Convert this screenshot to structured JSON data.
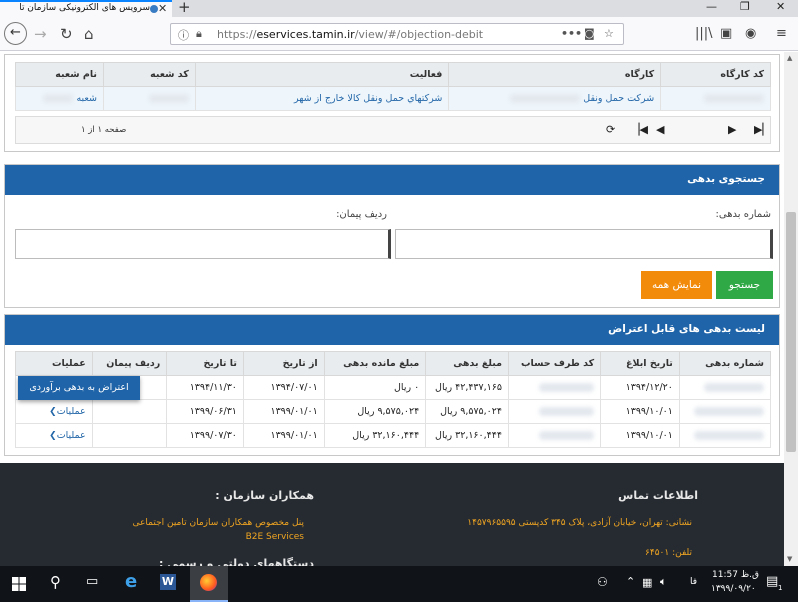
{
  "browser": {
    "tab_title": "سرویس های الکترونیکی سازمان تا",
    "url_prefix": "https://",
    "url_host": "eservices.tamin.ir",
    "url_path": "/view/#/objection-debit"
  },
  "workshop_table": {
    "headers": [
      "کد کارگاه",
      "کارگاه",
      "فعالیت",
      "کد شعبه",
      "نام شعبه"
    ],
    "row": {
      "company": "شرکت حمل ونقل",
      "activity": "شرکتهاي حمل ونقل کالا خارج از شهر",
      "branch_prefix": "شعبه"
    },
    "pager_text": "صفحه ۱ از ۱"
  },
  "search_panel": {
    "title": "جستجوی بدهی",
    "debt_number_label": "شماره بدهی:",
    "contract_row_label": "ردیف پیمان:",
    "search_button": "جستجو",
    "show_all_button": "نمایش همه"
  },
  "debt_list": {
    "title": "لیست بدهی های قابل اعتراض",
    "headers": [
      "شماره بدهی",
      "تاریخ ابلاغ",
      "کد طرف حساب",
      "مبلغ بدهی",
      "مبلغ مانده بدهی",
      "از تاریخ",
      "تا تاریخ",
      "ردیف پیمان",
      "عملیات"
    ],
    "rows": [
      {
        "notify_date": "۱۳۹۴/۱۲/۲۰",
        "amount": "۴۲,۴۳۷,۱۶۵ ریال",
        "remaining": "۰ ریال",
        "from": "۱۳۹۴/۰۷/۰۱",
        "to": "۱۳۹۴/۱۱/۳۰",
        "action": ""
      },
      {
        "notify_date": "۱۳۹۹/۱۰/۰۱",
        "amount": "۹,۵۷۵,۰۲۴ ریال",
        "remaining": "۹,۵۷۵,۰۲۴ ریال",
        "from": "۱۳۹۹/۰۱/۰۱",
        "to": "۱۳۹۹/۰۶/۳۱",
        "action": "عملیات"
      },
      {
        "notify_date": "۱۳۹۹/۱۰/۰۱",
        "amount": "۳۲,۱۶۰,۴۴۴ ریال",
        "remaining": "۳۲,۱۶۰,۴۴۴ ریال",
        "from": "۱۳۹۹/۰۱/۰۱",
        "to": "۱۳۹۹/۰۷/۳۰",
        "action": "عملیات"
      }
    ],
    "dropdown_item": "اعتراض به بدهی برآوردی"
  },
  "footer": {
    "contact_title": "اطلاعات تماس",
    "address": "نشانی: تهران، خیابان آزادی، پلاک ۳۴۵ کدپستی ۱۴۵۷۹۶۵۵۹۵",
    "phone": "تلفن: ۶۴۵۰۱",
    "partners_title": "همکاران سازمان :",
    "partners_link1": "پنل مخصوص همکاران سازمان تامین اجتماعی",
    "partners_link2": "B2E Services",
    "gov_title": "دستگاههای دولتی و رسمی :"
  },
  "taskbar": {
    "clock_time": "11:57 ق.ظ",
    "clock_date": "۱۳۹۹/۰۹/۲۰",
    "lang": "فا",
    "notif_count": "1"
  },
  "colors": {
    "primary": "#1f64a8",
    "green": "#2fa945",
    "orange": "#f28a0a",
    "footer_bg": "#262b31",
    "footer_link": "#f0a522"
  }
}
